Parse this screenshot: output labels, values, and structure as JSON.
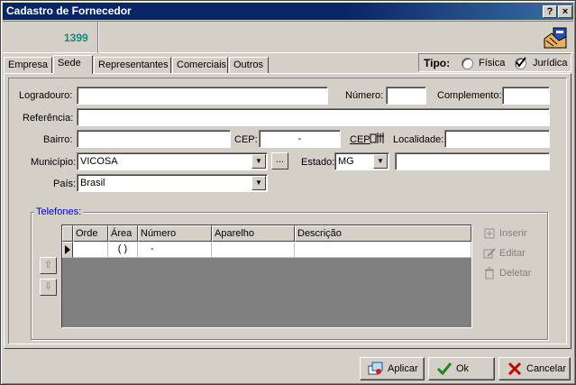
{
  "window": {
    "title": "Cadastro de Fornecedor",
    "help_label": "?",
    "close_label": "×"
  },
  "header": {
    "code": "1399",
    "icon": "supplier-icon"
  },
  "tabs": [
    {
      "label": "Empresa",
      "active": false
    },
    {
      "label": "Sede",
      "active": true
    },
    {
      "label": "Representantes",
      "active": false
    },
    {
      "label": "Comerciais",
      "active": false
    },
    {
      "label": "Outros",
      "active": false
    }
  ],
  "tipo": {
    "label": "Tipo:",
    "options": [
      {
        "label": "Física",
        "selected": false
      },
      {
        "label": "Jurídica",
        "selected": true
      }
    ]
  },
  "form": {
    "logradouro_label": "Logradouro:",
    "logradouro_value": "",
    "numero_label": "Número:",
    "numero_value": "",
    "complemento_label": "Complemento:",
    "complemento_value": "",
    "referencia_label": "Referência:",
    "referencia_value": "",
    "bairro_label": "Bairro:",
    "bairro_value": "",
    "cep_label": "CEP:",
    "cep_value": "-",
    "cep_link_label": "CEP",
    "localidade_label": "Localidade:",
    "localidade_value": "",
    "municipio_label": "Município:",
    "municipio_value": "VICOSA",
    "ellipsis_label": "...",
    "estado_label": "Estado:",
    "estado_value": "MG",
    "estado_extra": "",
    "pais_label": "País:",
    "pais_value": "Brasil"
  },
  "telefones": {
    "title": "Telefones:",
    "columns": [
      "Orde",
      "Área",
      "Número",
      "Aparelho",
      "Descrição"
    ],
    "row": {
      "ordem": "",
      "area": "(  )",
      "numero": "-",
      "aparelho": "",
      "descricao": ""
    },
    "actions": [
      {
        "label": "Inserir",
        "icon": "insert-icon"
      },
      {
        "label": "Editar",
        "icon": "edit-icon"
      },
      {
        "label": "Deletar",
        "icon": "delete-icon"
      }
    ]
  },
  "buttons": {
    "apply_label": "Aplicar",
    "ok_label": "Ok",
    "cancel_label": "Cancelar"
  },
  "colors": {
    "title_bar": "#0a246a",
    "code": "#138a7a",
    "group_title": "#0000c0",
    "ok_check": "#1a8a1a",
    "cancel_x": "#c00000"
  }
}
